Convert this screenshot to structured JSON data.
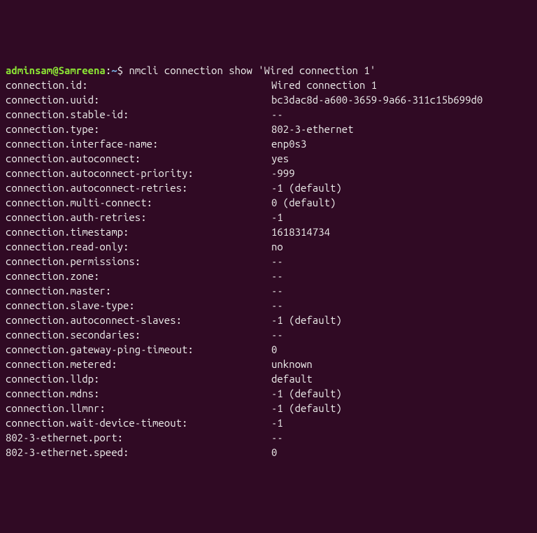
{
  "prompt": {
    "user_host": "adminsam@Samreena",
    "sep": ":",
    "path": "~",
    "dollar": "$ ",
    "command": "nmcli connection show 'Wired connection 1'"
  },
  "rows": [
    {
      "key": "connection.id:",
      "value": "Wired connection 1"
    },
    {
      "key": "connection.uuid:",
      "value": "bc3dac8d-a600-3659-9a66-311c15b699d0"
    },
    {
      "key": "connection.stable-id:",
      "value": "--"
    },
    {
      "key": "connection.type:",
      "value": "802-3-ethernet"
    },
    {
      "key": "connection.interface-name:",
      "value": "enp0s3"
    },
    {
      "key": "connection.autoconnect:",
      "value": "yes"
    },
    {
      "key": "connection.autoconnect-priority:",
      "value": "-999"
    },
    {
      "key": "connection.autoconnect-retries:",
      "value": "-1 (default)"
    },
    {
      "key": "connection.multi-connect:",
      "value": "0 (default)"
    },
    {
      "key": "connection.auth-retries:",
      "value": "-1"
    },
    {
      "key": "connection.timestamp:",
      "value": "1618314734"
    },
    {
      "key": "connection.read-only:",
      "value": "no"
    },
    {
      "key": "connection.permissions:",
      "value": "--"
    },
    {
      "key": "connection.zone:",
      "value": "--"
    },
    {
      "key": "connection.master:",
      "value": "--"
    },
    {
      "key": "connection.slave-type:",
      "value": "--"
    },
    {
      "key": "connection.autoconnect-slaves:",
      "value": "-1 (default)"
    },
    {
      "key": "connection.secondaries:",
      "value": "--"
    },
    {
      "key": "connection.gateway-ping-timeout:",
      "value": "0"
    },
    {
      "key": "connection.metered:",
      "value": "unknown"
    },
    {
      "key": "connection.lldp:",
      "value": "default"
    },
    {
      "key": "connection.mdns:",
      "value": "-1 (default)"
    },
    {
      "key": "connection.llmnr:",
      "value": "-1 (default)"
    },
    {
      "key": "connection.wait-device-timeout:",
      "value": "-1"
    },
    {
      "key": "802-3-ethernet.port:",
      "value": "--"
    },
    {
      "key": "802-3-ethernet.speed:",
      "value": "0"
    }
  ]
}
